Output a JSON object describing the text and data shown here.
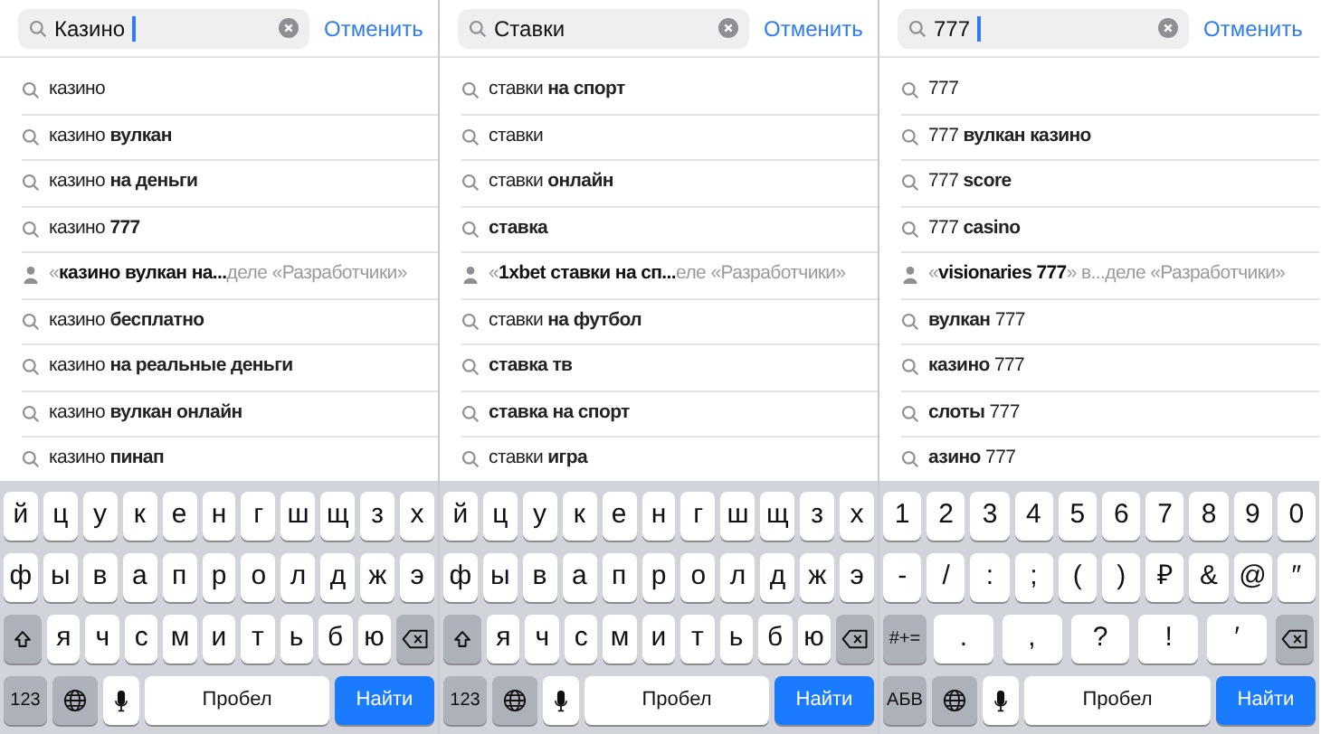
{
  "panels": [
    {
      "query": "Казино",
      "cursor": true,
      "cancel": "Отменить",
      "suggestions": [
        {
          "kind": "query",
          "text": "казино"
        },
        {
          "kind": "query",
          "text": "казино **вулкан**"
        },
        {
          "kind": "query",
          "text": "казино **на деньги**"
        },
        {
          "kind": "query",
          "text": "казино **777**"
        },
        {
          "kind": "developer",
          "text": "«**казино вулкан на...**деле «Разработчики»"
        },
        {
          "kind": "query",
          "text": "казино **бесплатно**"
        },
        {
          "kind": "query",
          "text": "казино **на реальные деньги**"
        },
        {
          "kind": "query",
          "text": "казино **вулкан онлайн**"
        },
        {
          "kind": "query",
          "text": "казино **пинап**"
        }
      ],
      "keyboard": [
        [
          {
            "kind": "char",
            "label": "й"
          },
          {
            "kind": "char",
            "label": "ц"
          },
          {
            "kind": "char",
            "label": "у"
          },
          {
            "kind": "char",
            "label": "к"
          },
          {
            "kind": "char",
            "label": "е"
          },
          {
            "kind": "char",
            "label": "н"
          },
          {
            "kind": "char",
            "label": "г"
          },
          {
            "kind": "char",
            "label": "ш"
          },
          {
            "kind": "char",
            "label": "щ"
          },
          {
            "kind": "char",
            "label": "з"
          },
          {
            "kind": "char",
            "label": "х"
          }
        ],
        [
          {
            "kind": "char",
            "label": "ф"
          },
          {
            "kind": "char",
            "label": "ы"
          },
          {
            "kind": "char",
            "label": "в"
          },
          {
            "kind": "char",
            "label": "а"
          },
          {
            "kind": "char",
            "label": "п"
          },
          {
            "kind": "char",
            "label": "р"
          },
          {
            "kind": "char",
            "label": "о"
          },
          {
            "kind": "char",
            "label": "л"
          },
          {
            "kind": "char",
            "label": "д"
          },
          {
            "kind": "char",
            "label": "ж"
          },
          {
            "kind": "char",
            "label": "э"
          }
        ],
        [
          {
            "kind": "shift"
          },
          {
            "kind": "char",
            "label": "я"
          },
          {
            "kind": "char",
            "label": "ч"
          },
          {
            "kind": "char",
            "label": "с"
          },
          {
            "kind": "char",
            "label": "м"
          },
          {
            "kind": "char",
            "label": "и"
          },
          {
            "kind": "char",
            "label": "т"
          },
          {
            "kind": "char",
            "label": "ь"
          },
          {
            "kind": "char",
            "label": "б"
          },
          {
            "kind": "char",
            "label": "ю"
          },
          {
            "kind": "backspace"
          }
        ],
        [
          {
            "kind": "mode",
            "label": "123"
          },
          {
            "kind": "globe"
          },
          {
            "kind": "mic"
          },
          {
            "kind": "space",
            "label": "Пробел"
          },
          {
            "kind": "search",
            "label": "Найти"
          }
        ]
      ]
    },
    {
      "query": "Ставки",
      "cursor": false,
      "cancel": "Отменить",
      "suggestions": [
        {
          "kind": "query",
          "text": "ставки **на спорт**"
        },
        {
          "kind": "query",
          "text": "ставки"
        },
        {
          "kind": "query",
          "text": "ставки **онлайн**"
        },
        {
          "kind": "query",
          "text": "**ставка**"
        },
        {
          "kind": "developer",
          "text": "«**1xbet ставки на сп...**еле «Разработчики»"
        },
        {
          "kind": "query",
          "text": "ставки **на футбол**"
        },
        {
          "kind": "query",
          "text": "**ставка тв**"
        },
        {
          "kind": "query",
          "text": "**ставка на спорт**"
        },
        {
          "kind": "query",
          "text": "ставки **игра**"
        }
      ],
      "keyboard": [
        [
          {
            "kind": "char",
            "label": "й"
          },
          {
            "kind": "char",
            "label": "ц"
          },
          {
            "kind": "char",
            "label": "у"
          },
          {
            "kind": "char",
            "label": "к"
          },
          {
            "kind": "char",
            "label": "е"
          },
          {
            "kind": "char",
            "label": "н"
          },
          {
            "kind": "char",
            "label": "г"
          },
          {
            "kind": "char",
            "label": "ш"
          },
          {
            "kind": "char",
            "label": "щ"
          },
          {
            "kind": "char",
            "label": "з"
          },
          {
            "kind": "char",
            "label": "х"
          }
        ],
        [
          {
            "kind": "char",
            "label": "ф"
          },
          {
            "kind": "char",
            "label": "ы"
          },
          {
            "kind": "char",
            "label": "в"
          },
          {
            "kind": "char",
            "label": "а"
          },
          {
            "kind": "char",
            "label": "п"
          },
          {
            "kind": "char",
            "label": "р"
          },
          {
            "kind": "char",
            "label": "о"
          },
          {
            "kind": "char",
            "label": "л"
          },
          {
            "kind": "char",
            "label": "д"
          },
          {
            "kind": "char",
            "label": "ж"
          },
          {
            "kind": "char",
            "label": "э"
          }
        ],
        [
          {
            "kind": "shift"
          },
          {
            "kind": "char",
            "label": "я"
          },
          {
            "kind": "char",
            "label": "ч"
          },
          {
            "kind": "char",
            "label": "с"
          },
          {
            "kind": "char",
            "label": "м"
          },
          {
            "kind": "char",
            "label": "и"
          },
          {
            "kind": "char",
            "label": "т"
          },
          {
            "kind": "char",
            "label": "ь"
          },
          {
            "kind": "char",
            "label": "б"
          },
          {
            "kind": "char",
            "label": "ю"
          },
          {
            "kind": "backspace"
          }
        ],
        [
          {
            "kind": "mode",
            "label": "123"
          },
          {
            "kind": "globe"
          },
          {
            "kind": "mic"
          },
          {
            "kind": "space",
            "label": "Пробел"
          },
          {
            "kind": "search",
            "label": "Найти"
          }
        ]
      ]
    },
    {
      "query": "777",
      "cursor": true,
      "cancel": "Отменить",
      "suggestions": [
        {
          "kind": "query",
          "text": "777"
        },
        {
          "kind": "query",
          "text": "777 **вулкан казино**"
        },
        {
          "kind": "query",
          "text": "777 **score**"
        },
        {
          "kind": "query",
          "text": "777 **casino**"
        },
        {
          "kind": "developer",
          "text": "«**visionaries 777**» в...деле «Разработчики»"
        },
        {
          "kind": "query",
          "text": "**вулкан** 777"
        },
        {
          "kind": "query",
          "text": "**казино** 777"
        },
        {
          "kind": "query",
          "text": "**слоты** 777"
        },
        {
          "kind": "query",
          "text": "**азино** 777"
        }
      ],
      "keyboard": [
        [
          {
            "kind": "char",
            "label": "1"
          },
          {
            "kind": "char",
            "label": "2"
          },
          {
            "kind": "char",
            "label": "3"
          },
          {
            "kind": "char",
            "label": "4"
          },
          {
            "kind": "char",
            "label": "5"
          },
          {
            "kind": "char",
            "label": "6"
          },
          {
            "kind": "char",
            "label": "7"
          },
          {
            "kind": "char",
            "label": "8"
          },
          {
            "kind": "char",
            "label": "9"
          },
          {
            "kind": "char",
            "label": "0"
          }
        ],
        [
          {
            "kind": "char",
            "label": "-"
          },
          {
            "kind": "char",
            "label": "/"
          },
          {
            "kind": "char",
            "label": ":"
          },
          {
            "kind": "char",
            "label": ";"
          },
          {
            "kind": "char",
            "label": "("
          },
          {
            "kind": "char",
            "label": ")"
          },
          {
            "kind": "char",
            "label": "₽"
          },
          {
            "kind": "char",
            "label": "&"
          },
          {
            "kind": "char",
            "label": "@"
          },
          {
            "kind": "char",
            "label": "″"
          }
        ],
        [
          {
            "kind": "mode",
            "label": "#+="
          },
          {
            "kind": "char",
            "label": "."
          },
          {
            "kind": "char",
            "label": ","
          },
          {
            "kind": "char",
            "label": "?"
          },
          {
            "kind": "char",
            "label": "!"
          },
          {
            "kind": "char",
            "label": "′"
          },
          {
            "kind": "backspace"
          }
        ],
        [
          {
            "kind": "mode",
            "label": "АБВ"
          },
          {
            "kind": "globe"
          },
          {
            "kind": "mic"
          },
          {
            "kind": "space",
            "label": "Пробел"
          },
          {
            "kind": "search",
            "label": "Найти"
          }
        ]
      ]
    }
  ]
}
